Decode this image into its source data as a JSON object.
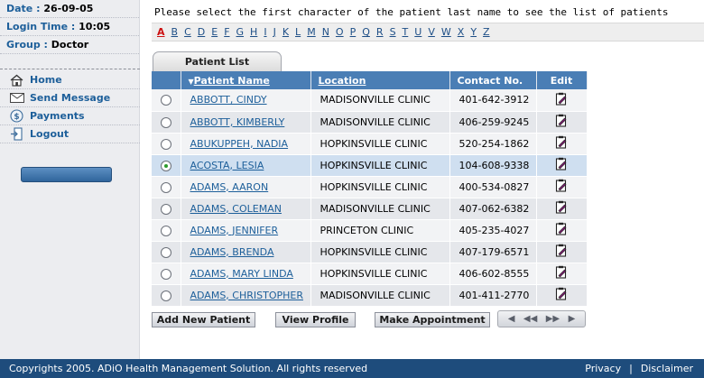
{
  "session": {
    "date_label": "Date : ",
    "date_value": "26-09-05",
    "login_label": "Login Time : ",
    "login_value": "10:05",
    "group_label": "Group : ",
    "group_value": "Doctor"
  },
  "nav": [
    {
      "label": "Home",
      "icon": "home-icon"
    },
    {
      "label": "Send Message",
      "icon": "envelope-icon"
    },
    {
      "label": "Payments",
      "icon": "dollar-icon"
    },
    {
      "label": "Logout",
      "icon": "logout-icon"
    }
  ],
  "instruction": "Please select the first character of the patient last name to see the list of patients",
  "alphabet": [
    "A",
    "B",
    "C",
    "D",
    "E",
    "F",
    "G",
    "H",
    "I",
    "J",
    "K",
    "L",
    "M",
    "N",
    "O",
    "P",
    "Q",
    "R",
    "S",
    "T",
    "U",
    "V",
    "W",
    "X",
    "Y",
    "Z"
  ],
  "alphabet_active": "A",
  "tab_label": "Patient List",
  "table": {
    "headers": {
      "name": "Patient Name",
      "location": "Location",
      "contact": "Contact No.",
      "edit": "Edit"
    },
    "rows": [
      {
        "name": "ABBOTT, CINDY",
        "location": "MADISONVILLE CLINIC",
        "contact": "401-642-3912",
        "selected": false
      },
      {
        "name": "ABBOTT, KIMBERLY",
        "location": "MADISONVILLE CLINIC",
        "contact": "406-259-9245",
        "selected": false
      },
      {
        "name": "ABUKUPPEH, NADIA",
        "location": "HOPKINSVILLE CLINIC",
        "contact": "520-254-1862",
        "selected": false
      },
      {
        "name": "ACOSTA, LESIA",
        "location": "HOPKINSVILLE CLINIC",
        "contact": "104-608-9338",
        "selected": true
      },
      {
        "name": "ADAMS, AARON",
        "location": "HOPKINSVILLE CLINIC",
        "contact": "400-534-0827",
        "selected": false
      },
      {
        "name": "ADAMS, COLEMAN",
        "location": "MADISONVILLE CLINIC",
        "contact": "407-062-6382",
        "selected": false
      },
      {
        "name": "ADAMS, JENNIFER",
        "location": "PRINCETON CLINIC",
        "contact": "405-235-4027",
        "selected": false
      },
      {
        "name": "ADAMS, BRENDA",
        "location": "HOPKINSVILLE CLINIC",
        "contact": "407-179-6571",
        "selected": false
      },
      {
        "name": "ADAMS, MARY LINDA",
        "location": "HOPKINSVILLE CLINIC",
        "contact": "406-602-8555",
        "selected": false
      },
      {
        "name": "ADAMS, CHRISTOPHER",
        "location": "MADISONVILLE CLINIC",
        "contact": "401-411-2770",
        "selected": false
      }
    ]
  },
  "actions": {
    "add": "Add New Patient",
    "view": "View Profile",
    "appointment": "Make Appointment"
  },
  "pager_icons": [
    "first-page-icon",
    "prev-page-icon",
    "next-page-icon",
    "last-page-icon"
  ],
  "footer": {
    "copyright": "Copyrights 2005. ADiO Health Management Solution. All rights reserved",
    "privacy": "Privacy",
    "separator": "|",
    "disclaimer": "Disclaimer"
  },
  "colors": {
    "header_blue": "#4a7eb5",
    "footer_blue": "#1e4c7c",
    "link_blue": "#1d5f9a",
    "selected_row": "#cfdff0",
    "active_letter": "#cc1111"
  }
}
